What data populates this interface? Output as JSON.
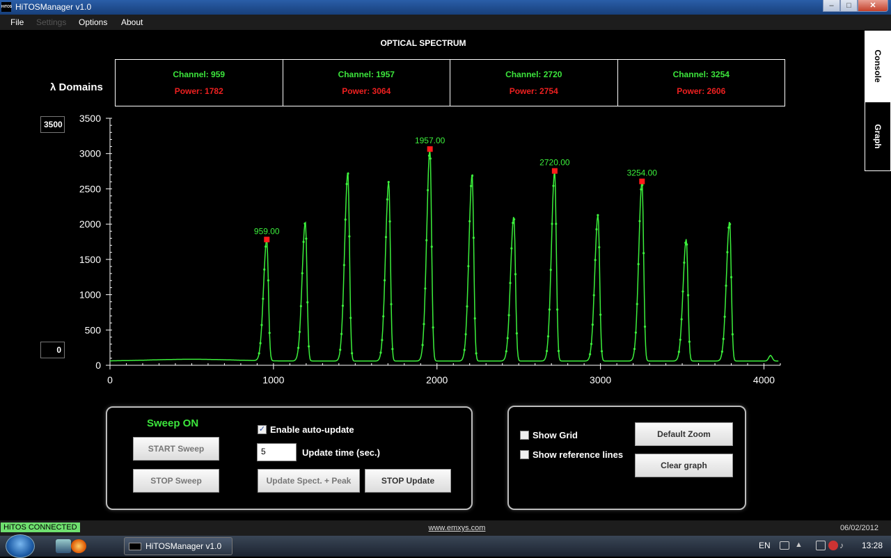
{
  "window": {
    "title": "HiTOSManager v1.0",
    "logo_text": "HiTOS"
  },
  "menu": {
    "items": [
      "File",
      "Settings",
      "Options",
      "About"
    ]
  },
  "header": {
    "chart_title": "OPTICAL SPECTRUM",
    "domains_label": "λ Domains",
    "domains": [
      {
        "channel": "Channel: 959",
        "power": "Power: 1782"
      },
      {
        "channel": "Channel: 1957",
        "power": "Power: 3064"
      },
      {
        "channel": "Channel: 2720",
        "power": "Power: 2754"
      },
      {
        "channel": "Channel: 3254",
        "power": "Power: 2606"
      }
    ]
  },
  "y_inputs": {
    "max": "3500",
    "min": "0"
  },
  "tabs": {
    "console": "Console",
    "graph": "Graph"
  },
  "chart_data": {
    "type": "line",
    "xlim": [
      0,
      4100
    ],
    "ylim": [
      0,
      3500
    ],
    "x_ticks": [
      0,
      1000,
      2000,
      3000,
      4000
    ],
    "y_ticks": [
      0,
      500,
      1000,
      1500,
      2000,
      2500,
      3000,
      3500
    ],
    "baseline": 60,
    "peaks": [
      {
        "x": 959,
        "y": 1782
      },
      {
        "x": 1195,
        "y": 2030
      },
      {
        "x": 1455,
        "y": 2730
      },
      {
        "x": 1705,
        "y": 2600
      },
      {
        "x": 1957,
        "y": 3064
      },
      {
        "x": 2215,
        "y": 2700
      },
      {
        "x": 2470,
        "y": 2110
      },
      {
        "x": 2720,
        "y": 2754
      },
      {
        "x": 2985,
        "y": 2130
      },
      {
        "x": 3254,
        "y": 2606
      },
      {
        "x": 3525,
        "y": 1790
      },
      {
        "x": 3790,
        "y": 2040
      }
    ],
    "markers": [
      {
        "x": 959,
        "y": 1782,
        "label": "959.00"
      },
      {
        "x": 1957,
        "y": 3064,
        "label": "1957.00"
      },
      {
        "x": 2720,
        "y": 2754,
        "label": "2720.00"
      },
      {
        "x": 3254,
        "y": 2606,
        "label": "3254.00"
      }
    ],
    "line_color": "#3cf03c",
    "marker_color": "#ff1a1a",
    "grid": false
  },
  "sweep": {
    "status": "Sweep ON",
    "start_label": "START Sweep",
    "stop_label": "STOP Sweep",
    "auto_update_label": "Enable auto-update",
    "auto_update_checked": "✓",
    "update_time_label": "Update time (sec.)",
    "update_time_value": "5",
    "update_label": "Update Spect. + Peak",
    "stop_update_label": "STOP Update"
  },
  "view": {
    "show_grid_label": "Show Grid",
    "show_ref_label": "Show reference lines",
    "default_zoom_label": "Default Zoom",
    "clear_graph_label": "Clear graph"
  },
  "status": {
    "connection": "HiTOS CONNECTED",
    "website": "www.emxys.com",
    "date": "06/02/2012"
  },
  "taskbar": {
    "app_label": "HiTOSManager v1.0",
    "lang": "EN",
    "time": "13:28"
  }
}
